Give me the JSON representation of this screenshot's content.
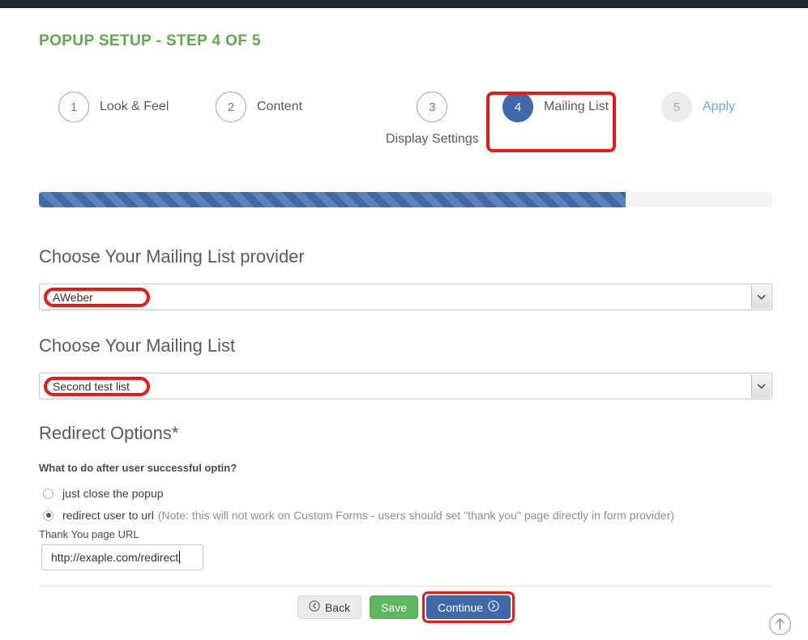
{
  "page": {
    "title": "POPUP SETUP - STEP 4 OF 5",
    "title_color": "#5cab4b"
  },
  "steps": {
    "items": [
      {
        "number": "1",
        "label": "Look & Feel",
        "state": "pending"
      },
      {
        "number": "2",
        "label": "Content",
        "state": "pending"
      },
      {
        "number": "3",
        "label": "Display Settings",
        "state": "pending"
      },
      {
        "number": "4",
        "label": "Mailing List",
        "state": "active"
      },
      {
        "number": "5",
        "label": "Apply",
        "state": "disabled"
      }
    ],
    "active_color": "#4069ab",
    "pending_color": "#5b7ab5",
    "disabled_color": "#a8a8a8"
  },
  "progress": {
    "percent": 80,
    "fill_color": "#4069ab",
    "track_color": "#f4f4f4"
  },
  "provider": {
    "heading": "Choose Your Mailing List provider",
    "selected": "AWeber"
  },
  "mailing_list": {
    "heading": "Choose Your Mailing List",
    "selected": "Second test list"
  },
  "redirect": {
    "heading": "Redirect Options*",
    "question": "What to do after user successful optin?",
    "option_close": "just close the popup",
    "option_redirect": "redirect user to url",
    "option_redirect_note": "(Note: this will not work on Custom Forms - users should set \"thank you\" page directly in form provider)",
    "url_label": "Thank You page URL",
    "url_value": "http://exaple.com/redirect",
    "url_placeholder": "http://"
  },
  "buttons": {
    "back": "Back",
    "save": "Save",
    "continue": "Continue"
  },
  "annotations": {
    "highlight_color": "#e81919",
    "targets": [
      "step-4-mailing-list",
      "provider-selected-value",
      "mailing-list-selected-value",
      "continue-button"
    ]
  }
}
